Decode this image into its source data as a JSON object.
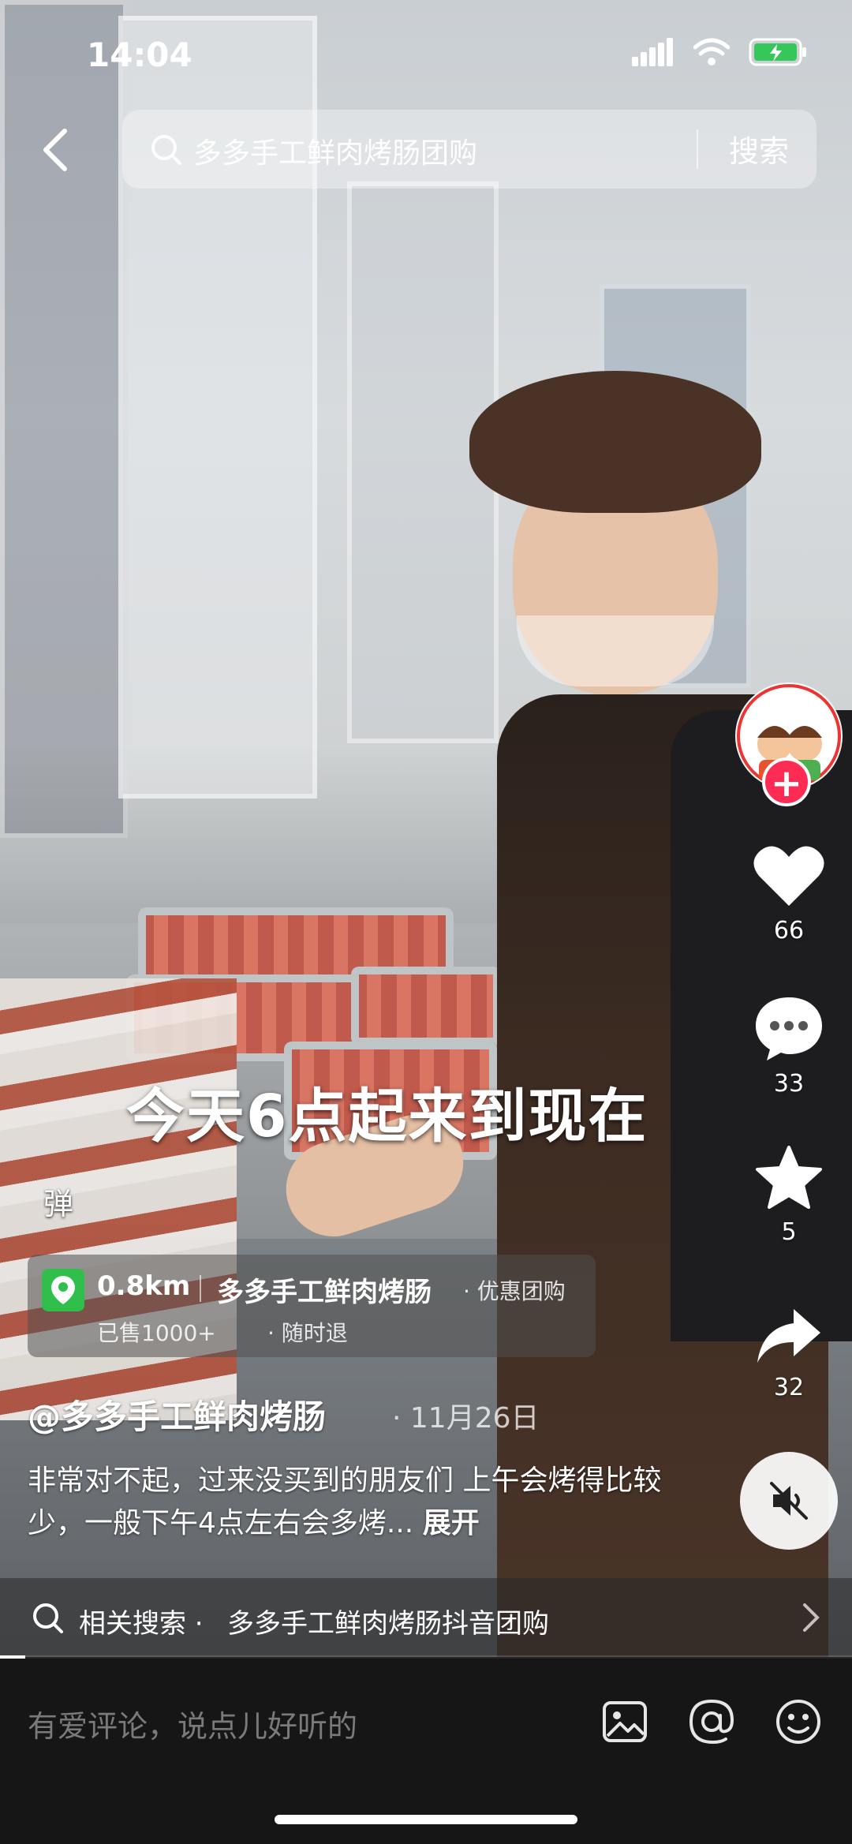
{
  "status_bar": {
    "time": "14:04"
  },
  "search": {
    "query": "多多手工鲜肉烤肠团购",
    "button_label": "搜索"
  },
  "video": {
    "subtitle": "今天6点起来到现在",
    "danmu_toggle": "弹"
  },
  "author_avatar": {
    "shop_name": "手工鲜肉烤肠"
  },
  "actions": {
    "likes": "66",
    "comments": "33",
    "favorites": "5",
    "shares": "32"
  },
  "poi": {
    "distance": "0.8km",
    "name": "多多手工鲜肉烤肠",
    "tag": "· 优惠团购",
    "sold": "已售1000+",
    "refund": "· 随时退"
  },
  "post": {
    "author": "@多多手工鲜肉烤肠",
    "date": "· 11月26日",
    "caption": "非常对不起，过来没买到的朋友们 上午会烤得比较少，一般下午4点左右会多烤...",
    "expand_label": "展开"
  },
  "related_search": {
    "label": "相关搜索 ·",
    "query": "多多手工鲜肉烤肠抖音团购"
  },
  "playback": {
    "progress": 0.03
  },
  "comment_bar": {
    "placeholder": "有爱评论，说点儿好听的"
  },
  "colors": {
    "accent": "#fe2c55",
    "poi_green": "#2fbf4a",
    "bottom_bar": "#161616"
  }
}
